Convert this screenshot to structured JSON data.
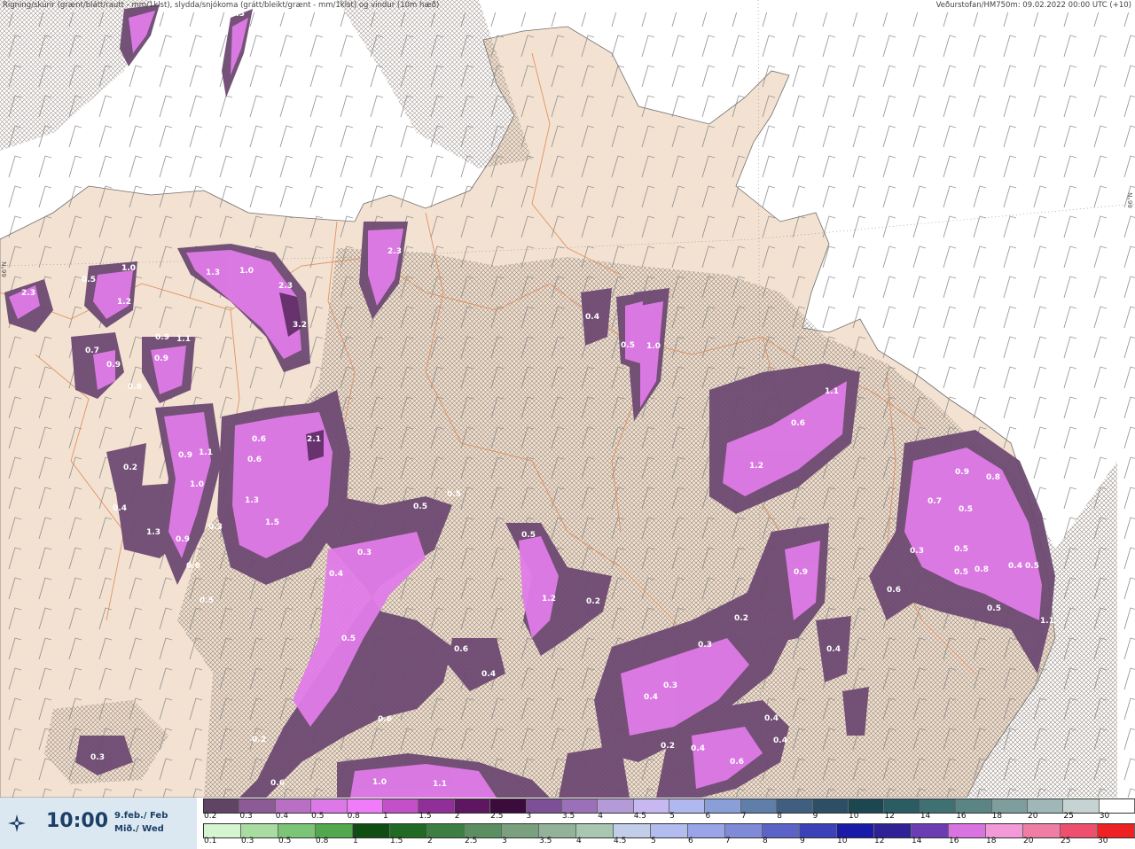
{
  "header": {
    "left_text": "Rigning/skúrir (grænt/blátt/rautt - mm/1klst), slydda/snjókoma (grátt/bleikt/grænt - mm/1klst) og vindur (10m hæð)",
    "right_text": "Veðurstofan/HM750m: 09.02.2022 00:00 UTC (+10)"
  },
  "grid_labels": [
    "66°N",
    "66°N"
  ],
  "time_panel": {
    "icon": "wind-compass-icon",
    "time": "10:00",
    "date_line1": "9.feb./ Feb",
    "date_line2": "Mið./ Wed"
  },
  "legend_snow": {
    "labels": [
      "0.2",
      "0.3",
      "0.4",
      "0.5",
      "0.8",
      "1",
      "1.5",
      "2",
      "2.5",
      "3",
      "3.5",
      "4",
      "4.5",
      "5",
      "6",
      "7",
      "8",
      "9",
      "10",
      "12",
      "14",
      "16",
      "18",
      "20",
      "25",
      "30"
    ],
    "colors": [
      "#5f4463",
      "#8c5a94",
      "#b96fc3",
      "#dc78e8",
      "#f07cf9",
      "#c34fc9",
      "#8f2f97",
      "#5d165f",
      "#3a0b3b",
      "#7d4f96",
      "#9a71b8",
      "#b49ad6",
      "#c8b8f2",
      "#b0b8f0",
      "#8a9ed8",
      "#5f7ea8",
      "#3f5e80",
      "#2d4f66",
      "#1d4750",
      "#2a5c62",
      "#3f7072",
      "#5a8584",
      "#7d9e9d",
      "#9fb7b6",
      "#c5d4d3",
      "#ffffff"
    ]
  },
  "legend_rain": {
    "labels": [
      "0.1",
      "0.3",
      "0.5",
      "0.8",
      "1",
      "1.5",
      "2",
      "2.5",
      "3",
      "3.5",
      "4",
      "4.5",
      "5",
      "6",
      "7",
      "8",
      "9",
      "10",
      "12",
      "14",
      "16",
      "18",
      "20",
      "25",
      "30"
    ],
    "colors": [
      "#d4f5d0",
      "#a8dca0",
      "#7cc476",
      "#52a84e",
      "#0f4d12",
      "#1f6a25",
      "#3c7f43",
      "#5b8f61",
      "#7aa080",
      "#92b39a",
      "#a9c6b0",
      "#c2cdea",
      "#b2bcee",
      "#9aa4e6",
      "#7f8ad8",
      "#5b63c8",
      "#3c41b8",
      "#1a1aa8",
      "#2e2296",
      "#6a3db2",
      "#d873e0",
      "#f29ad8",
      "#f07ea4",
      "#ee4f6f",
      "#ee2222"
    ]
  },
  "map_values": [
    {
      "v": "2.3"
    },
    {
      "v": "1.0"
    },
    {
      "v": "2.3"
    },
    {
      "v": "1.2"
    },
    {
      "v": "1.0"
    },
    {
      "v": "0.5"
    },
    {
      "v": "0.9"
    },
    {
      "v": "0.7"
    },
    {
      "v": "0.9"
    },
    {
      "v": "1.1"
    },
    {
      "v": "0.9"
    },
    {
      "v": "0.8"
    },
    {
      "v": "2.3"
    },
    {
      "v": "1.0"
    },
    {
      "v": "1.3"
    },
    {
      "v": "3.2"
    },
    {
      "v": "2.3"
    },
    {
      "v": "0.4"
    },
    {
      "v": "0.5"
    },
    {
      "v": "1.0"
    },
    {
      "v": "1.1"
    },
    {
      "v": "0.6"
    },
    {
      "v": "1.2"
    },
    {
      "v": "0.9"
    },
    {
      "v": "0.8"
    },
    {
      "v": "0.7"
    },
    {
      "v": "0.5"
    },
    {
      "v": "0.3"
    },
    {
      "v": "0.5"
    },
    {
      "v": "0.5"
    },
    {
      "v": "0.8"
    },
    {
      "v": "0.5"
    },
    {
      "v": "0.4"
    },
    {
      "v": "0.6"
    },
    {
      "v": "0.5"
    },
    {
      "v": "1.1"
    },
    {
      "v": "0.6"
    },
    {
      "v": "2.1"
    },
    {
      "v": "0.6"
    },
    {
      "v": "1.3"
    },
    {
      "v": "1.5"
    },
    {
      "v": "1.0"
    },
    {
      "v": "1.1"
    },
    {
      "v": "0.9"
    },
    {
      "v": "0.2"
    },
    {
      "v": "0.4"
    },
    {
      "v": "1.3"
    },
    {
      "v": "0.9"
    },
    {
      "v": "0.8"
    },
    {
      "v": "0.3"
    },
    {
      "v": "0.5"
    },
    {
      "v": "0.3"
    },
    {
      "v": "0.4"
    },
    {
      "v": "0.5"
    },
    {
      "v": "0.5"
    },
    {
      "v": "0.5"
    },
    {
      "v": "1.2"
    },
    {
      "v": "0.2"
    },
    {
      "v": "0.9"
    },
    {
      "v": "0.2"
    },
    {
      "v": "0.3"
    },
    {
      "v": "0.4"
    },
    {
      "v": "0.3"
    },
    {
      "v": "0.4"
    },
    {
      "v": "0.5"
    },
    {
      "v": "0.6"
    },
    {
      "v": "0.4"
    },
    {
      "v": "0.6"
    },
    {
      "v": "0.4"
    },
    {
      "v": "0.2"
    },
    {
      "v": "0.4"
    },
    {
      "v": "0.6"
    },
    {
      "v": "0.4"
    },
    {
      "v": "0.3"
    },
    {
      "v": "0.2"
    },
    {
      "v": "0.6"
    },
    {
      "v": "1.0"
    },
    {
      "v": "1.1"
    }
  ]
}
